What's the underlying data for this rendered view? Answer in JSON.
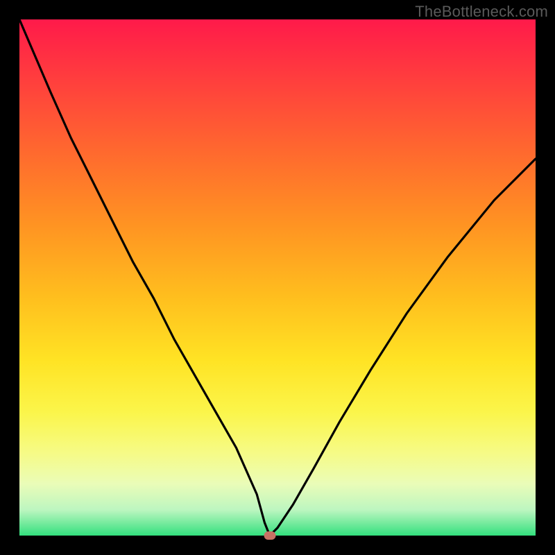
{
  "watermark": "TheBottleneck.com",
  "chart_data": {
    "type": "line",
    "title": "",
    "xlabel": "",
    "ylabel": "",
    "xlim": [
      0,
      100
    ],
    "ylim": [
      0,
      100
    ],
    "series": [
      {
        "name": "bottleneck-curve",
        "x": [
          0,
          3,
          6,
          10,
          14,
          18,
          22,
          26,
          30,
          34,
          38,
          42,
          46,
          47.5,
          48.5,
          50,
          53,
          57,
          62,
          68,
          75,
          83,
          92,
          100
        ],
        "y": [
          100,
          93,
          86,
          77,
          69,
          61,
          53,
          46,
          38,
          31,
          24,
          17,
          8,
          2.5,
          0,
          1.5,
          6,
          13,
          22,
          32,
          43,
          54,
          65,
          73
        ]
      }
    ],
    "marker": {
      "x": 48.5,
      "y": 0
    },
    "grid": false,
    "legend": false
  },
  "colors": {
    "curve": "#000000",
    "marker": "#c77164",
    "gradient_top": "#ff1a4a",
    "gradient_bottom": "#33e07e",
    "frame": "#000000"
  }
}
